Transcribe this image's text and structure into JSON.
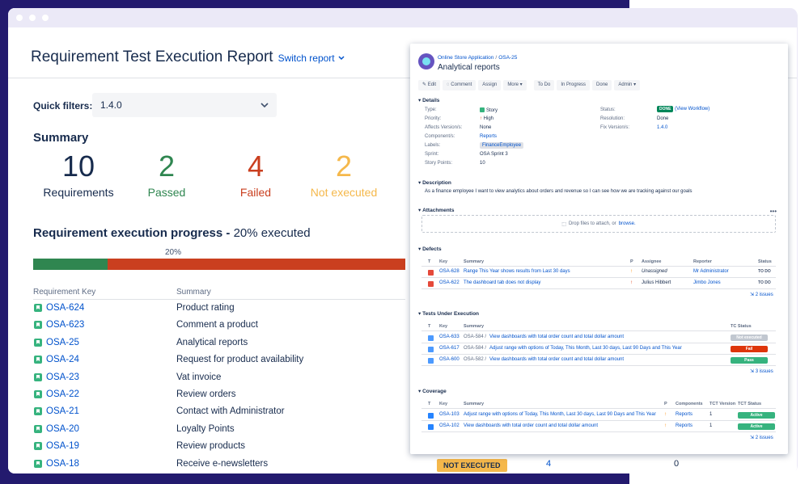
{
  "colors": {
    "passed": "#2f8650",
    "failed": "#ca3f1f",
    "not_executed": "#f5b84b",
    "link": "#0052cc"
  },
  "report": {
    "title": "Requirement Test Execution Report",
    "switch_label": "Switch report",
    "quick_filters_label": "Quick filters:",
    "quick_filter_value": "1.4.0",
    "summary_heading": "Summary",
    "stats": [
      {
        "value": "10",
        "label": "Requirements"
      },
      {
        "value": "2",
        "label": "Passed"
      },
      {
        "value": "4",
        "label": "Failed"
      },
      {
        "value": "2",
        "label": "Not executed"
      }
    ],
    "progress_heading": "Requirement execution progress",
    "progress_dash": " - ",
    "progress_executed_text": "20% executed",
    "progress_percent_label": "20%",
    "progress_fraction": 0.2,
    "table_headers": {
      "key": "Requirement Key",
      "summary": "Summary"
    },
    "rows": [
      {
        "key": "OSA-624",
        "summary": "Product rating"
      },
      {
        "key": "OSA-623",
        "summary": "Comment a product"
      },
      {
        "key": "OSA-25",
        "summary": "Analytical reports"
      },
      {
        "key": "OSA-24",
        "summary": "Request for product availability"
      },
      {
        "key": "OSA-23",
        "summary": "Vat invoice"
      },
      {
        "key": "OSA-22",
        "summary": "Review orders"
      },
      {
        "key": "OSA-21",
        "summary": "Contact with Administrator"
      },
      {
        "key": "OSA-20",
        "summary": "Loyalty Points"
      },
      {
        "key": "OSA-19",
        "summary": "Review products"
      },
      {
        "key": "OSA-18",
        "summary": "Receive e-newsletters"
      }
    ],
    "last_row_status": "NOT EXECUTED",
    "last_row_count_a": "4",
    "last_row_count_b": "0"
  },
  "issue": {
    "project": "Online Store Application",
    "key": "OSA-25",
    "title": "Analytical reports",
    "toolbar": [
      "Edit",
      "Comment",
      "Assign",
      "More",
      "To Do",
      "In Progress",
      "Done",
      "Admin"
    ],
    "details_heading": "Details",
    "details_left": [
      {
        "label": "Type:",
        "value": "Story"
      },
      {
        "label": "Priority:",
        "value": "High"
      },
      {
        "label": "Affects Version/s:",
        "value": "None"
      },
      {
        "label": "Component/s:",
        "value": "Reports"
      },
      {
        "label": "Labels:",
        "value": "FinanceEmployee"
      },
      {
        "label": "Sprint:",
        "value": "OSA Sprint 3"
      },
      {
        "label": "Story Points:",
        "value": "10"
      }
    ],
    "status_label": "Status:",
    "status_badge": "DONE",
    "status_link": "(View Workflow)",
    "resolution_label": "Resolution:",
    "resolution_value": "Done",
    "fix_label": "Fix Version/s:",
    "fix_value": "1.4.0",
    "description_heading": "Description",
    "description": "As a finance employee I want to view analytics about orders and revenue so I can see how we are tracking against our goals",
    "attachments_heading": "Attachments",
    "drop_text": "Drop files to attach, or",
    "browse": "browse.",
    "defects_heading": "Defects",
    "defects_cols": {
      "t": "T",
      "key": "Key",
      "summary": "Summary",
      "p": "P",
      "assignee": "Assignee",
      "reporter": "Reporter",
      "status": "Status"
    },
    "defects": [
      {
        "key": "OSA-628",
        "summary": "Range This Year shows results from Last 30 days",
        "assignee": "Unassigned",
        "reporter": "Mr Administrator",
        "status": "TO DO",
        "priority_color": "#ff8b00"
      },
      {
        "key": "OSA-622",
        "summary": "The dashboard tab does not display",
        "assignee": "Julius Hibbert",
        "reporter": "Jimbo Jones",
        "status": "TO DO",
        "priority_color": "#de350b"
      }
    ],
    "defects_count": "2 issues",
    "tests_heading": "Tests Under Execution",
    "tests_cols": {
      "t": "T",
      "key": "Key",
      "summary": "Summary",
      "tc_status": "TC Status"
    },
    "tests": [
      {
        "key": "OSA-633",
        "parent": "OSA-584 /",
        "summary": "View dashboards with total order count and total dollar amount",
        "status": "Not executed",
        "color": "#c1c7d0"
      },
      {
        "key": "OSA-617",
        "parent": "OSA-584 /",
        "summary": "Adjust range with options of Today, This Month, Last 30 days, Last 90 Days and This Year",
        "status": "Fail",
        "color": "#de350b"
      },
      {
        "key": "OSA-600",
        "parent": "OSA-582 /",
        "summary": "View dashboards with total order count and total dollar amount",
        "status": "Pass",
        "color": "#36b37e"
      }
    ],
    "tests_count": "3 issues",
    "coverage_heading": "Coverage",
    "coverage_cols": {
      "t": "T",
      "key": "Key",
      "summary": "Summary",
      "p": "P",
      "components": "Components",
      "tct_version": "TCT Version",
      "tct_status": "TCT Status"
    },
    "coverage": [
      {
        "key": "OSA-103",
        "summary": "Adjust range with options of Today, This Month, Last 30 days, Last 90 Days and This Year",
        "component": "Reports",
        "version": "1",
        "status": "Active"
      },
      {
        "key": "OSA-102",
        "summary": "View dashboards with total order count and total dollar amount",
        "component": "Reports",
        "version": "1",
        "status": "Active"
      }
    ],
    "coverage_count": "2 issues"
  }
}
